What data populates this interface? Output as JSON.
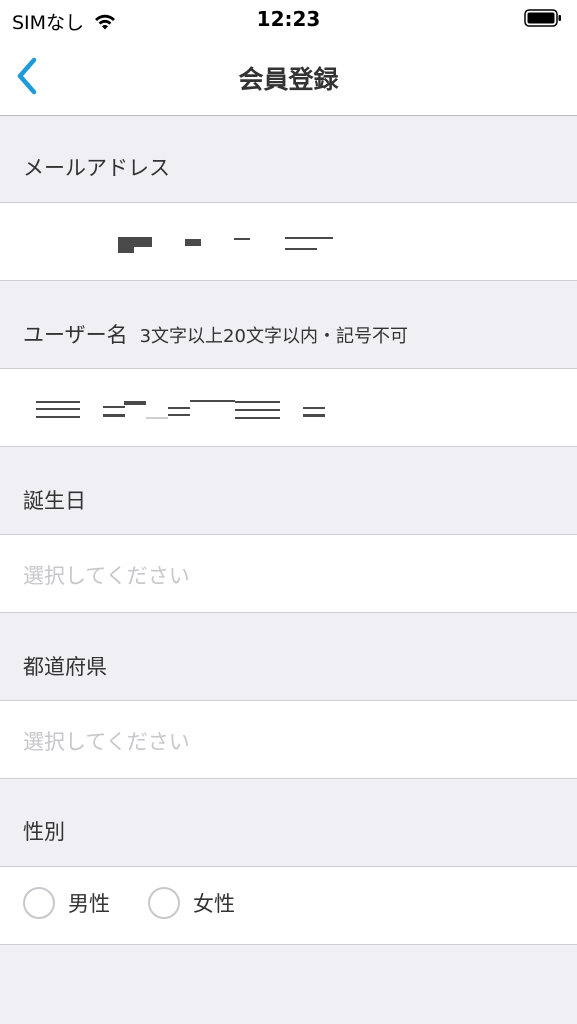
{
  "status_bar": {
    "carrier": "SIMなし",
    "time": "12:23",
    "wifi_icon": "wifi-icon",
    "battery_icon": "battery-icon"
  },
  "nav": {
    "title": "会員登録",
    "back_icon": "chevron-left-icon",
    "accent_color": "#1e9bd7"
  },
  "form": {
    "email": {
      "label": "メールアドレス",
      "value_redacted": true
    },
    "username": {
      "label": "ユーザー名",
      "hint": "3文字以上20文字以内・記号不可",
      "value_redacted": true
    },
    "birthday": {
      "label": "誕生日",
      "placeholder": "選択してください"
    },
    "prefecture": {
      "label": "都道府県",
      "placeholder": "選択してください"
    },
    "gender": {
      "label": "性別",
      "options": [
        {
          "label": "男性",
          "selected": false
        },
        {
          "label": "女性",
          "selected": false
        }
      ]
    }
  }
}
